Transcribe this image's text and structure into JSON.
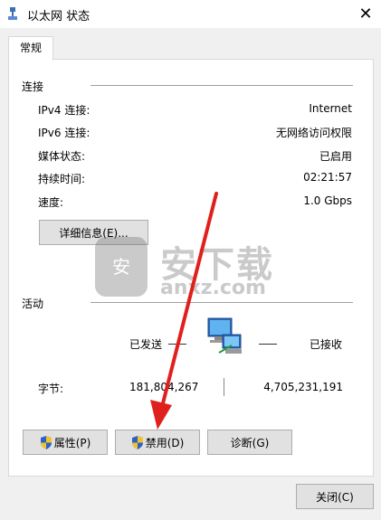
{
  "window": {
    "title": "以太网 状态",
    "close_glyph": "✕"
  },
  "tabs": [
    {
      "label": "常规"
    }
  ],
  "connection": {
    "section_label": "连接",
    "rows": [
      {
        "label": "IPv4 连接:",
        "value": "Internet"
      },
      {
        "label": "IPv6 连接:",
        "value": "无网络访问权限"
      },
      {
        "label": "媒体状态:",
        "value": "已启用"
      },
      {
        "label": "持续时间:",
        "value": "02:21:57"
      },
      {
        "label": "速度:",
        "value": "1.0 Gbps"
      }
    ],
    "details_button": "详细信息(E)..."
  },
  "activity": {
    "section_label": "活动",
    "sent_label": "已发送",
    "received_label": "已接收",
    "bytes_label": "字节:",
    "bytes_sent": "181,804,267",
    "bytes_received": "4,705,231,191"
  },
  "buttons": {
    "properties": "属性(P)",
    "disable": "禁用(D)",
    "diagnose": "诊断(G)",
    "close": "关闭(C)"
  },
  "watermark": {
    "cn": "安下载",
    "en": "anxz.com",
    "badge": "安"
  },
  "colors": {
    "annotation_arrow": "#e0201c",
    "shield_blue": "#2a63c6",
    "shield_yellow": "#f2c230"
  }
}
